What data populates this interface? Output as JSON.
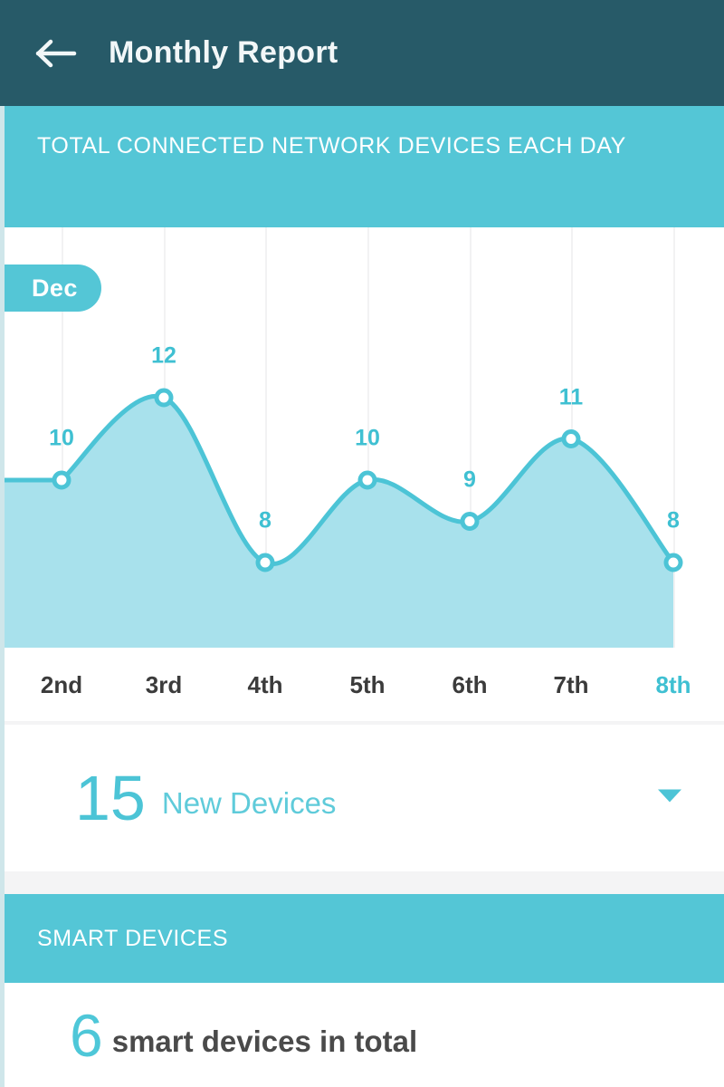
{
  "appbar": {
    "title": "Monthly Report",
    "back_icon": "arrow-left-icon"
  },
  "network_section": {
    "banner_title": "TOTAL CONNECTED NETWORK DEVICES EACH DAY",
    "month_badge": "Dec"
  },
  "new_devices": {
    "count": "15",
    "label": "New Devices",
    "caret_icon": "chevron-down-icon"
  },
  "smart_section": {
    "banner_title": "SMART DEVICES",
    "count": "6",
    "label": "smart devices in total"
  },
  "colors": {
    "appbar_bg": "#275a68",
    "accent": "#54c6d6",
    "line": "#4cc4d6",
    "area_fill": "#a8e1ec",
    "gridline": "#f2f2f3",
    "axis_text": "#3b3b3b",
    "page_bg": "#f4f4f5"
  },
  "chart_data": {
    "type": "area",
    "title": "TOTAL CONNECTED NETWORK DEVICES EACH DAY",
    "subtitle": "Dec",
    "xlabel": "",
    "ylabel": "",
    "categories": [
      "2nd",
      "3rd",
      "4th",
      "5th",
      "6th",
      "7th",
      "8th"
    ],
    "values": [
      10,
      12,
      8,
      10,
      9,
      11,
      8
    ],
    "point_labels": [
      "10",
      "12",
      "8",
      "10",
      "9",
      "11",
      "8"
    ],
    "active_category": "8th",
    "ylim": [
      0,
      14
    ],
    "grid": true,
    "legend": "none",
    "smoothing": "spline",
    "series": [
      {
        "name": "Connected network devices",
        "values": [
          10,
          12,
          8,
          10,
          9,
          11,
          8
        ]
      }
    ]
  }
}
